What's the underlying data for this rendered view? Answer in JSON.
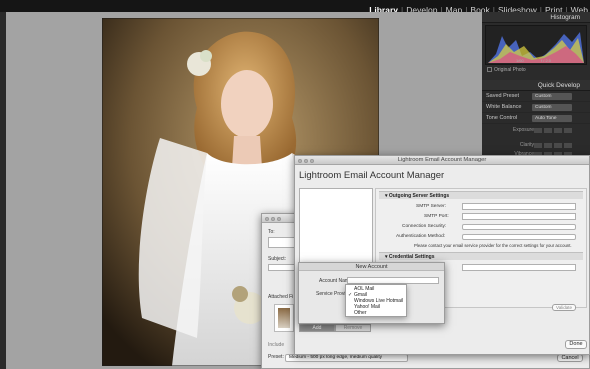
{
  "modules": [
    "Library",
    "Develop",
    "Map",
    "Book",
    "Slideshow",
    "Print",
    "Web"
  ],
  "active_module": "Library",
  "right_panel": {
    "histogram_title": "Histogram",
    "histogram_readout": [
      "1/60",
      "f / 2.0"
    ],
    "original_photo": "Original Photo",
    "quick_develop_title": "Quick Develop",
    "saved_preset": {
      "label": "Saved Preset",
      "value": "Custom"
    },
    "white_balance": {
      "label": "White Balance",
      "value": "Custom"
    },
    "tone_control": {
      "label": "Tone Control",
      "value": "Auto Tone"
    },
    "sliders": [
      "Exposure",
      "Clarity",
      "Vibrance"
    ]
  },
  "email_dialog": {
    "to_label": "To:",
    "subject_label": "Subject:",
    "attached_label": "Attached Fi",
    "include_label": "Include",
    "preset_label": "Preset:",
    "preset_value": "Medium - 500 px long edge, medium quality",
    "cancel": "Cancel"
  },
  "account_manager": {
    "window_title": "Lightroom Email Account Manager",
    "heading": "Lightroom Email Account Manager",
    "outgoing_section": "Outgoing Server Settings",
    "outgoing_fields": [
      "SMTP Server:",
      "SMTP Port:",
      "Connection Security:",
      "Authentication Method:"
    ],
    "note": "Please contact your email service provider for the correct settings for your account.",
    "credential_section": "Credential Settings",
    "validate": "Validate",
    "add": "Add",
    "remove": "Remove",
    "done": "Done"
  },
  "new_account": {
    "title": "New Account",
    "account_name_label": "Account Name:",
    "service_provider_label": "Service Provider:",
    "options": [
      "AOL Mail",
      "Gmail",
      "Windows Live Hotmail",
      "Yahoo! Mail",
      "Other"
    ],
    "checked_option": "Gmail"
  }
}
